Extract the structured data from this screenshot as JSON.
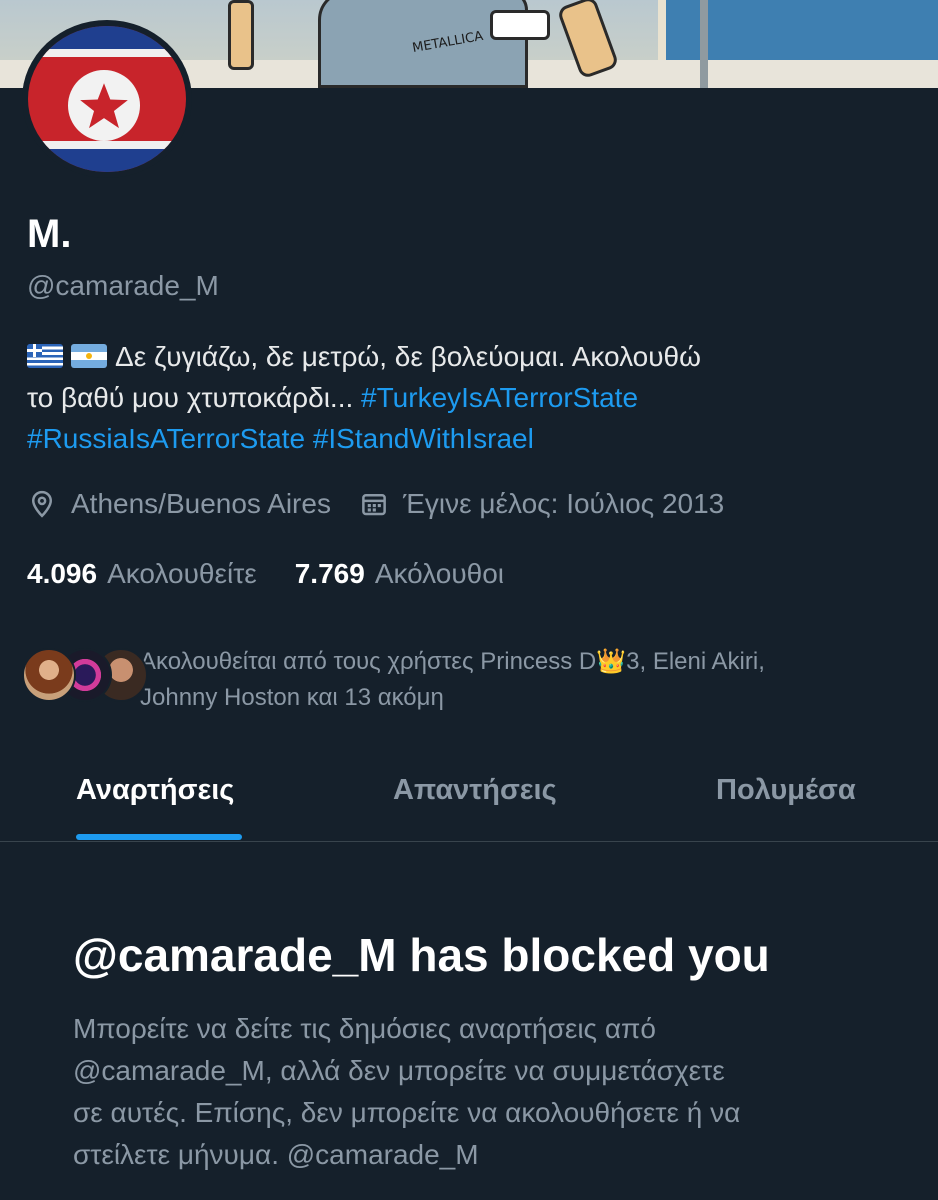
{
  "banner": {
    "shirt_text": "METALLICA"
  },
  "profile": {
    "display_name": "M.",
    "handle": "@camarade_M",
    "bio_text_1": "Δε ζυγιάζω, δε μετρώ, δε βολεύομαι. Ακολουθώ",
    "bio_text_2": "το βαθύ μου χτυποκάρδι...",
    "hashtag_1": "#TurkeyIsATerrorState",
    "hashtag_2": "#RussiaIsATerrorState",
    "hashtag_3": "#IStandWithIsrael",
    "location": "Athens/Buenos Aires",
    "joined": "Έγινε μέλος: Ιούλιος 2013"
  },
  "stats": {
    "following_count": "4.096",
    "following_label": "Ακολουθείτε",
    "followers_count": "7.769",
    "followers_label": "Ακόλουθοι"
  },
  "followed_by": {
    "line_1": "Ακολουθείται από τους χρήστες Princess D👑3, Eleni Akiri,",
    "line_2": "Johnny Hoston και 13 ακόμη"
  },
  "tabs": [
    {
      "label": "Αναρτήσεις",
      "active": true
    },
    {
      "label": "Απαντήσεις",
      "active": false
    },
    {
      "label": "Πολυμέσα",
      "active": false
    }
  ],
  "blocked": {
    "title": "@camarade_M has blocked you",
    "line_1": "Μπορείτε να δείτε τις δημόσιες αναρτήσεις από",
    "line_2": "@camarade_M, αλλά δεν μπορείτε να συμμετάσχετε",
    "line_3": "σε αυτές. Επίσης, δεν μπορείτε να ακολουθήσετε ή να",
    "line_4": "στείλετε μήνυμα. @camarade_M"
  },
  "icons": {
    "location": "location-pin-icon",
    "calendar": "calendar-icon"
  },
  "colors": {
    "background": "#15202b",
    "accent": "#1d9bf0",
    "secondary_text": "#8b98a5",
    "divider": "#38444d"
  }
}
